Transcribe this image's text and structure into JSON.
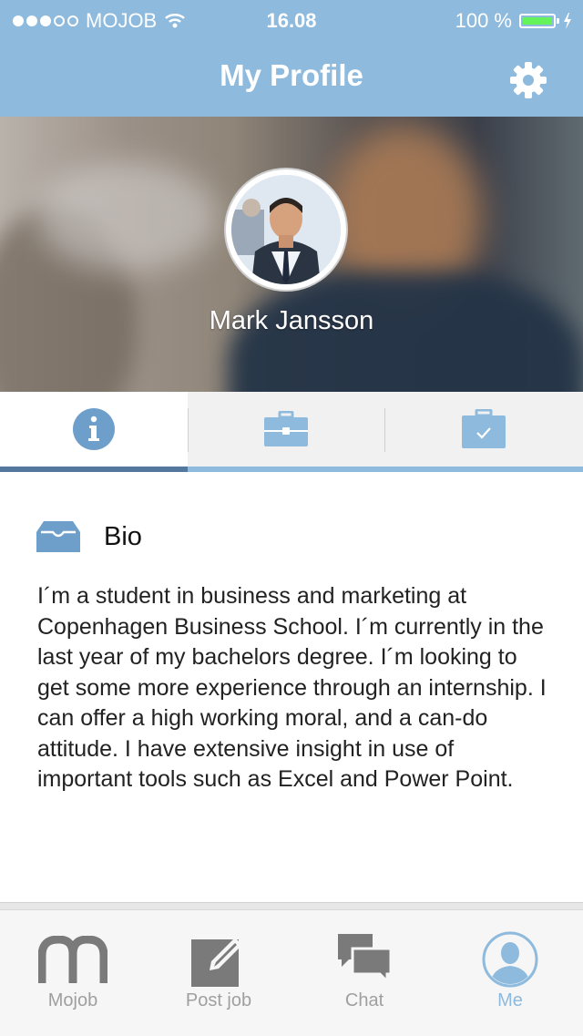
{
  "status_bar": {
    "carrier": "MOJOB",
    "time": "16.08",
    "battery": "100 %"
  },
  "header": {
    "title": "My Profile"
  },
  "profile": {
    "name": "Mark Jansson"
  },
  "tabs": [
    {
      "name": "info",
      "icon": "info-icon",
      "active": true
    },
    {
      "name": "work",
      "icon": "briefcase-icon",
      "active": false
    },
    {
      "name": "tasks",
      "icon": "checked-clipboard-icon",
      "active": false
    }
  ],
  "bio": {
    "title": "Bio",
    "text": "I´m a student in business and marketing at Copenhagen Business School. I´m currently in the last year of my bachelors degree. I´m looking to get some more experience through an internship. I can offer a high working moral, and a can-do attitude. I have extensive insight in use of important tools such as Excel and Power Point."
  },
  "tabbar": {
    "items": [
      {
        "label": "Mojob",
        "icon": "mojob-logo-icon",
        "active": false
      },
      {
        "label": "Post job",
        "icon": "edit-icon",
        "active": false
      },
      {
        "label": "Chat",
        "icon": "chat-bubbles-icon",
        "active": false
      },
      {
        "label": "Me",
        "icon": "user-icon",
        "active": true
      }
    ]
  },
  "colors": {
    "accent": "#8dbadd",
    "accent_dark": "#54779d",
    "battery_fill": "#64f35a",
    "inactive_gray": "#9f9f9f"
  }
}
